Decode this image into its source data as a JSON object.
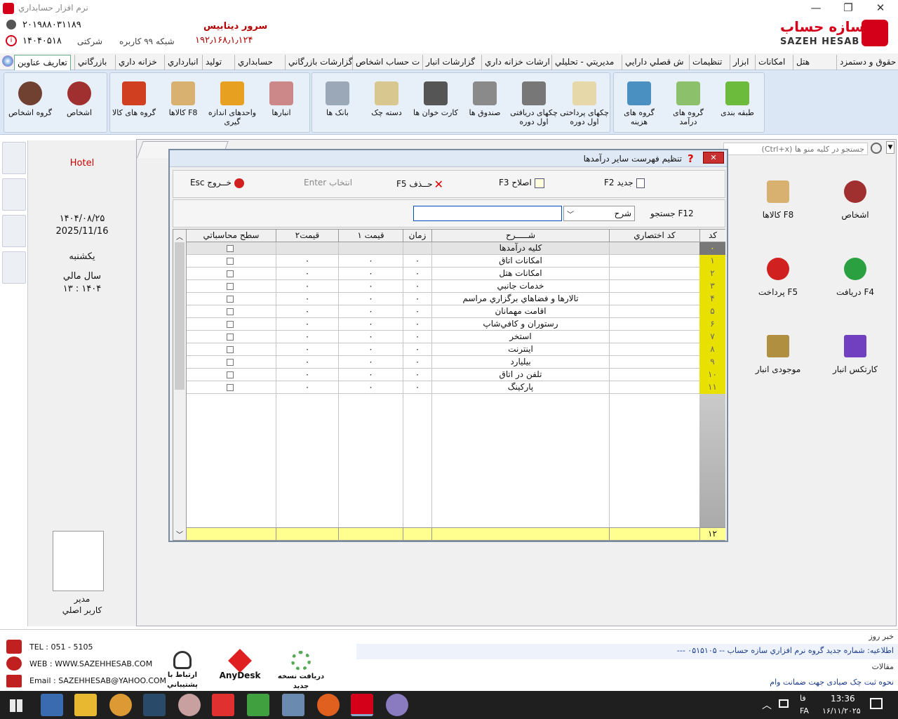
{
  "window": {
    "title": "نرم افزار حسابداري",
    "minimize": "—",
    "restore": "❐",
    "close": "✕"
  },
  "header": {
    "phone1": "۲۰۱۹۸۸۰۳۱۱۸۹",
    "serial": "۱۴۰۴۰۵۱۸",
    "company_type": "شرکتی",
    "network": "شبکه ۹۹ کاربره",
    "server_label": "سرور ديتابيس",
    "server_ip": "۱۹۲٫۱۶۸٫۱٫۱۲۴",
    "brand_fa": "سازه حساب",
    "brand_en": "SAZEH HESAB"
  },
  "menu": [
    {
      "label": "حقوق و دستمزد"
    },
    {
      "label": "هتل"
    },
    {
      "label": "امکانات"
    },
    {
      "label": "ابزار"
    },
    {
      "label": "تنظيمات"
    },
    {
      "label": "ش قصلي دارايي"
    },
    {
      "label": "مديريتي - تحليلي"
    },
    {
      "label": "ارشات خزانه داري"
    },
    {
      "label": "گزارشات انبار"
    },
    {
      "label": "ت حساب اشخاص"
    },
    {
      "label": "گزارشات بازرگاني"
    },
    {
      "label": "حسابداري"
    },
    {
      "label": "توليد"
    },
    {
      "label": "انبارداري"
    },
    {
      "label": "خزانه داري"
    },
    {
      "label": "بازرگاني"
    },
    {
      "label": "تعاريف عناوين"
    }
  ],
  "ribbon": {
    "classification": "طبقه بندی",
    "income_groups": "گروه های درآمد",
    "expense_groups": "گروه های هزينه",
    "received_cheques": "چکهای دريافتی اول دوره",
    "paid_cheques": "چکهای پرداختی اول دوره",
    "cash_boxes": "صندوق ها",
    "card_readers": "کارت خوان ها",
    "cheque_books": "دسته چک",
    "banks": "بانک ها",
    "warehouses": "انبارها",
    "units": "واحدهای اندازه گيری",
    "goods": "F8  کالاها",
    "goods_groups": "گروه های کالا",
    "persons": "اشخاص",
    "person_groups": "گروه اشخاص"
  },
  "info": {
    "hotel": "Hotel",
    "date_fa": "۱۴۰۴/۰۸/۲۵",
    "date_en": "2025/11/16",
    "weekday": "يکشنبه",
    "fiscal_label": "سال مالي",
    "fiscal_value": "۱۴۰۴ : ۱۳",
    "user_role": "مدير",
    "user_name": "کاربر اصلي"
  },
  "menu_search": {
    "placeholder": "جستجو در کليه منو ها (Ctrl+x)"
  },
  "quick": {
    "persons": "اشخاص",
    "goods": "F8  کالاها",
    "receive": "F4  دريافت",
    "pay": "F5  پرداخت",
    "stock_card": "کارتکس انبار",
    "stock": "موجودی انبار"
  },
  "dialog": {
    "title": "تنظيم فهرست ساير درآمدها",
    "btn_new": "جديد F2",
    "btn_edit": "اصلاح   F3",
    "btn_delete": "حــذف F5",
    "btn_select": "انتخاب Enter",
    "btn_exit": "خــروج Esc",
    "search_label": "F12 جستجو",
    "search_field": "شرح",
    "search_value": "",
    "columns": {
      "code": "کد",
      "short_code": "کد اختصاري",
      "desc": "شـــــرح",
      "time": "زمان",
      "price1": "قيمت ۱",
      "price2": "قيمت۲",
      "level": "سطح محاسباتي"
    },
    "rows": [
      {
        "code": "۰",
        "desc": "کليه درآمدها",
        "time": "",
        "price1": "",
        "price2": ""
      },
      {
        "code": "۱",
        "desc": "امکانات اتاق",
        "time": "۰",
        "price1": "۰",
        "price2": "۰"
      },
      {
        "code": "۲",
        "desc": "امکانات هتل",
        "time": "۰",
        "price1": "۰",
        "price2": "۰"
      },
      {
        "code": "۳",
        "desc": "خدمات جانبي",
        "time": "۰",
        "price1": "۰",
        "price2": "۰"
      },
      {
        "code": "۴",
        "desc": "تالارها و فضاهاي برگزاري مراسم",
        "time": "۰",
        "price1": "۰",
        "price2": "۰"
      },
      {
        "code": "۵",
        "desc": "اقامت مهمانان",
        "time": "۰",
        "price1": "۰",
        "price2": "۰"
      },
      {
        "code": "۶",
        "desc": "رستوران و کافي‌شاپ",
        "time": "۰",
        "price1": "۰",
        "price2": "۰"
      },
      {
        "code": "۷",
        "desc": "استخر",
        "time": "۰",
        "price1": "۰",
        "price2": "۰"
      },
      {
        "code": "۸",
        "desc": "اينترنت",
        "time": "۰",
        "price1": "۰",
        "price2": "۰"
      },
      {
        "code": "۹",
        "desc": "بيليارد",
        "time": "۰",
        "price1": "۰",
        "price2": "۰"
      },
      {
        "code": "۱۰",
        "desc": "تلفن در اتاق",
        "time": "۰",
        "price1": "۰",
        "price2": "۰"
      },
      {
        "code": "۱۱",
        "desc": "پارکينگ",
        "time": "۰",
        "price1": "۰",
        "price2": "۰"
      }
    ],
    "total": "۱۲"
  },
  "bottom": {
    "tel": "TEL : 051 - 5105",
    "web": "WEB : WWW.SAZEHHESAB.COM",
    "email": "Email : SAZEHHESAB@YAHOO.COM",
    "support": "ارتباط با پشتيباني",
    "anydesk": "AnyDesk",
    "update": "دريافت نسخه جديد",
    "news_title": "خبر روز",
    "news_text": "اطلاعيه: شماره جديد گروه نرم افزاري سازه حساب -- ۰۵۱۵۱۰۵ ---",
    "articles_title": "مقالات",
    "article_text": "نحوه ثبت چک صيادی جهت ضمانت وام"
  },
  "taskbar": {
    "time": "13:36",
    "date": "۱۶/۱۱/۲۰۲۵",
    "lang": "FA",
    "ime": "فا"
  },
  "colors": {
    "accent": "#d4001a",
    "ribbon": "#dbe7f5",
    "idcell": "#e8e000",
    "footer": "#ffff90"
  }
}
